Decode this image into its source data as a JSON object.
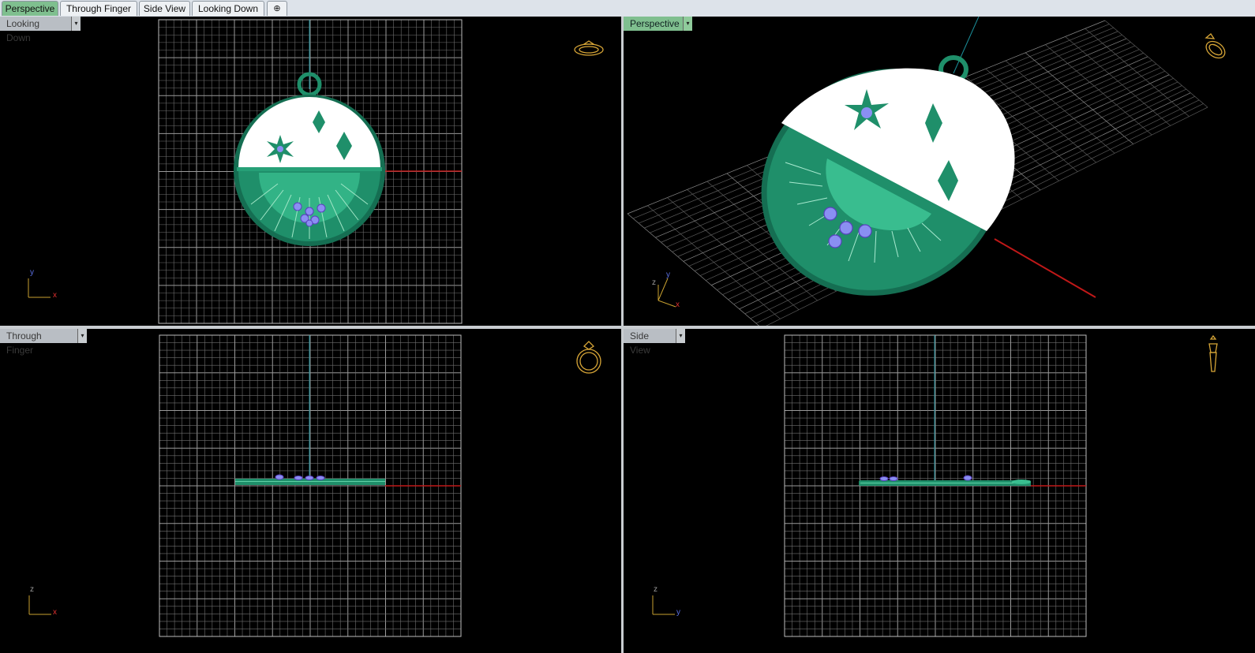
{
  "tabs": [
    {
      "label": "Perspective",
      "active": true
    },
    {
      "label": "Through Finger",
      "active": false
    },
    {
      "label": "Side View",
      "active": false
    },
    {
      "label": "Looking Down",
      "active": false
    }
  ],
  "add_tab_symbol": "⊕",
  "viewports": {
    "top_left": {
      "label": "Looking Down",
      "axis_h": "x",
      "axis_v": "y"
    },
    "top_right": {
      "label": "Perspective",
      "axis_h": "x",
      "axis_v": "y",
      "axis_z": "z"
    },
    "bottom_left": {
      "label": "Through Finger",
      "axis_h": "x",
      "axis_v": "z"
    },
    "bottom_right": {
      "label": "Side View",
      "axis_h": "y",
      "axis_v": "z"
    }
  },
  "dropdown_symbol": "▾",
  "colors": {
    "background": "#000000",
    "grid": "#6f6f6f",
    "grid_border": "#bdbdbd",
    "model": "#1f8f6a",
    "model_light": "#3fbf92",
    "gem": "#8a8ff2",
    "x_axis": "#c01818",
    "vertical_axis": "#1b8f9a",
    "active_tab": "#7fbf8f",
    "nav_icon": "#d8a637"
  },
  "icons": [
    "ring-top-view-icon",
    "ring-perspective-icon",
    "ring-front-view-icon",
    "ring-side-view-icon",
    "add-tab-icon",
    "dropdown-arrow-icon"
  ]
}
